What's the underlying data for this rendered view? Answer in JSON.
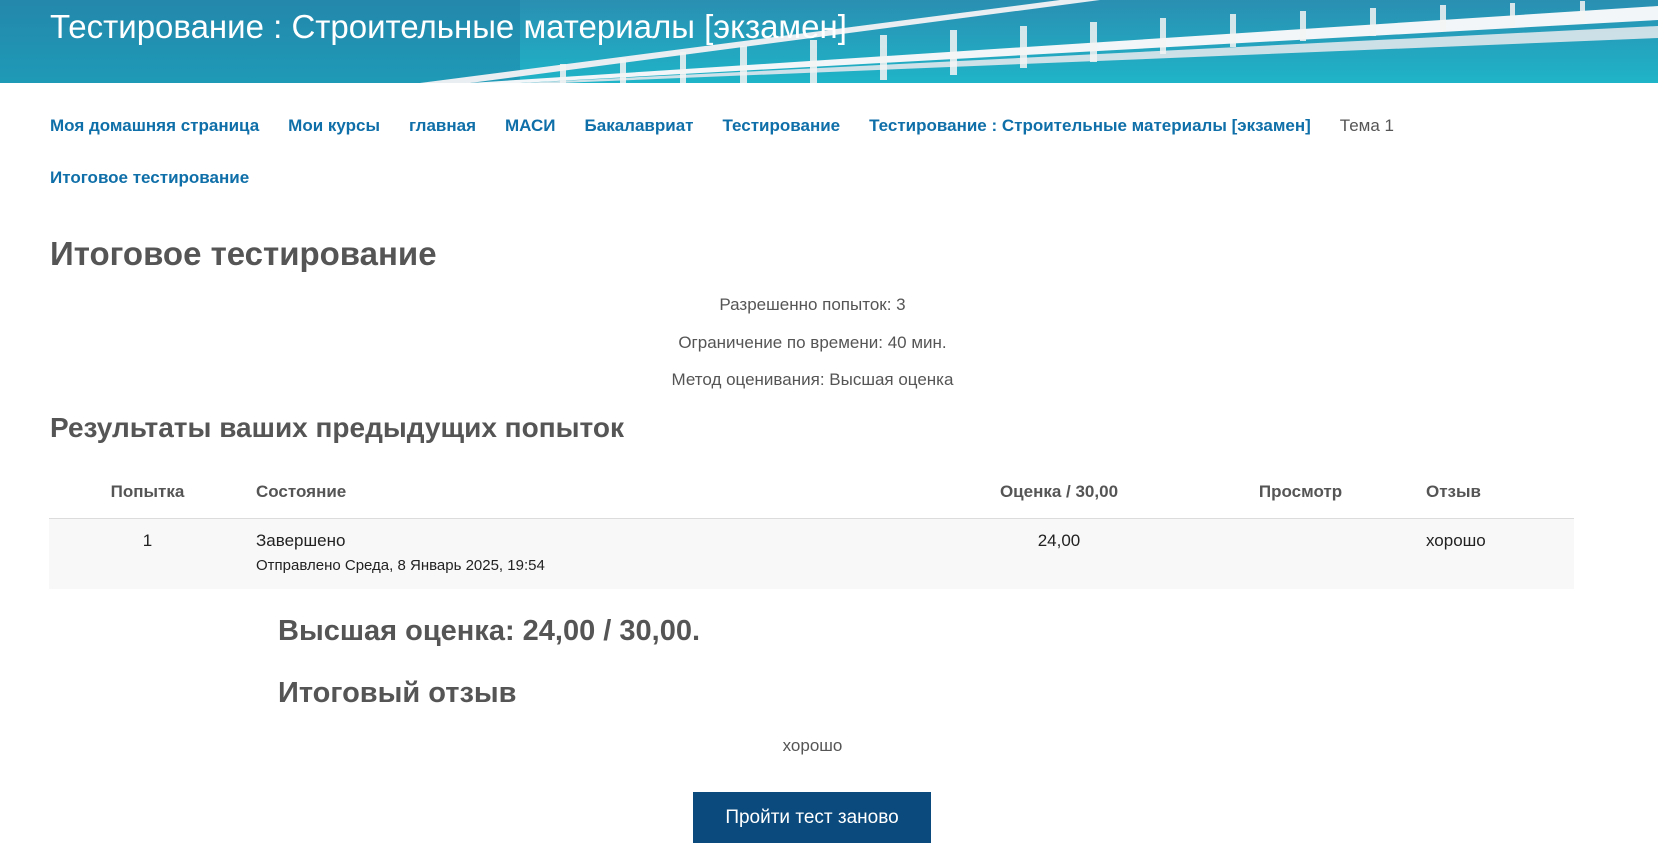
{
  "header": {
    "title": "Тестирование : Строительные материалы [экзамен]"
  },
  "breadcrumb": {
    "items": [
      "Моя домашняя страница",
      "Мои курсы",
      "главная",
      "МАСИ",
      "Бакалавриат",
      "Тестирование",
      "Тестирование : Строительные материалы [экзамен]"
    ],
    "current_section": "Тема 1",
    "last": "Итоговое тестирование"
  },
  "page": {
    "title": "Итоговое тестирование",
    "attempts_allowed": "Разрешенно попыток: 3",
    "time_limit": "Ограничение по времени: 40 мин.",
    "grading_method": "Метод оценивания: Высшая оценка"
  },
  "results": {
    "title": "Результаты ваших предыдущих попыток",
    "columns": {
      "attempt": "Попытка",
      "state": "Состояние",
      "grade": "Оценка / 30,00",
      "view": "Просмотр",
      "review": "Отзыв"
    },
    "rows": [
      {
        "attempt": "1",
        "state": "Завершено",
        "submitted": "Отправлено Среда, 8 Январь 2025, 19:54",
        "grade": "24,00",
        "view": "",
        "review": "хорошо"
      }
    ]
  },
  "summary": {
    "best_grade": "Высшая оценка: 24,00 / 30,00.",
    "final_feedback_title": "Итоговый отзыв",
    "final_feedback_text": "хорошо"
  },
  "actions": {
    "retry_label": "Пройти тест заново"
  }
}
